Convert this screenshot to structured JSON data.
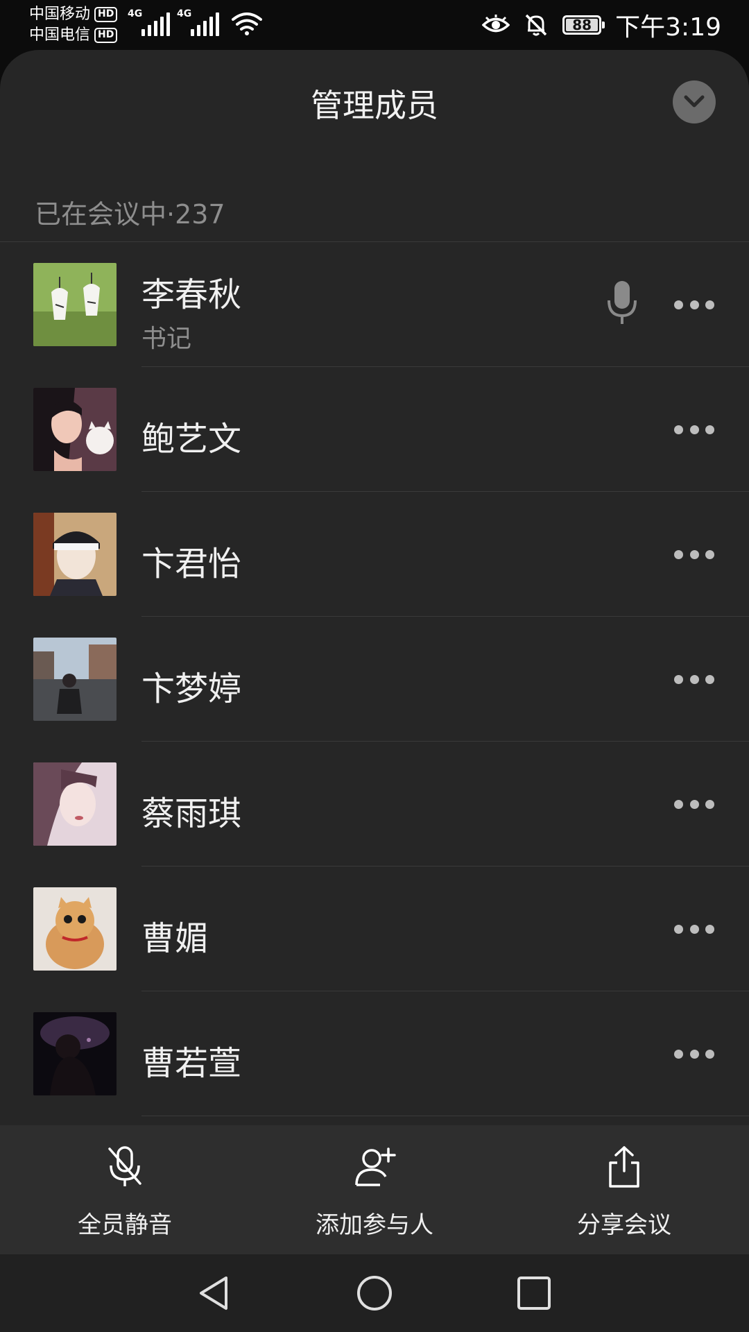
{
  "status_bar": {
    "carrier_1": "中国移动",
    "carrier_2": "中国电信",
    "hd_label": "HD",
    "network_1": "4G",
    "network_2": "4G",
    "battery": "88",
    "time": "下午3:19",
    "icons": [
      "signal-icon",
      "wifi-icon",
      "eye-icon",
      "bell-off-icon",
      "battery-icon"
    ]
  },
  "sheet": {
    "title": "管理成员",
    "collapse_icon": "chevron-down-icon",
    "section_label": "已在会议中·237"
  },
  "members": [
    {
      "name": "李春秋",
      "role": "书记",
      "avatar": "wind-chime-photo",
      "mic": true
    },
    {
      "name": "鲍艺文",
      "role": "",
      "avatar": "anime-girl-cat",
      "mic": false
    },
    {
      "name": "卞君怡",
      "role": "",
      "avatar": "anime-boy-headband",
      "mic": false
    },
    {
      "name": "卞梦婷",
      "role": "",
      "avatar": "street-photo",
      "mic": false
    },
    {
      "name": "蔡雨琪",
      "role": "",
      "avatar": "portrait-girl",
      "mic": false
    },
    {
      "name": "曹媚",
      "role": "",
      "avatar": "orange-cat",
      "mic": false
    },
    {
      "name": "曹若萱",
      "role": "",
      "avatar": "dark-silhouette",
      "mic": false
    }
  ],
  "toolbar": {
    "mute_all": "全员静音",
    "add_participant": "添加参与人",
    "share_meeting": "分享会议"
  },
  "colors": {
    "sheet_bg": "#262626",
    "toolbar_bg": "#2e2e2e",
    "secondary_text": "#8e8e8e",
    "divider": "#3a3a3a"
  }
}
